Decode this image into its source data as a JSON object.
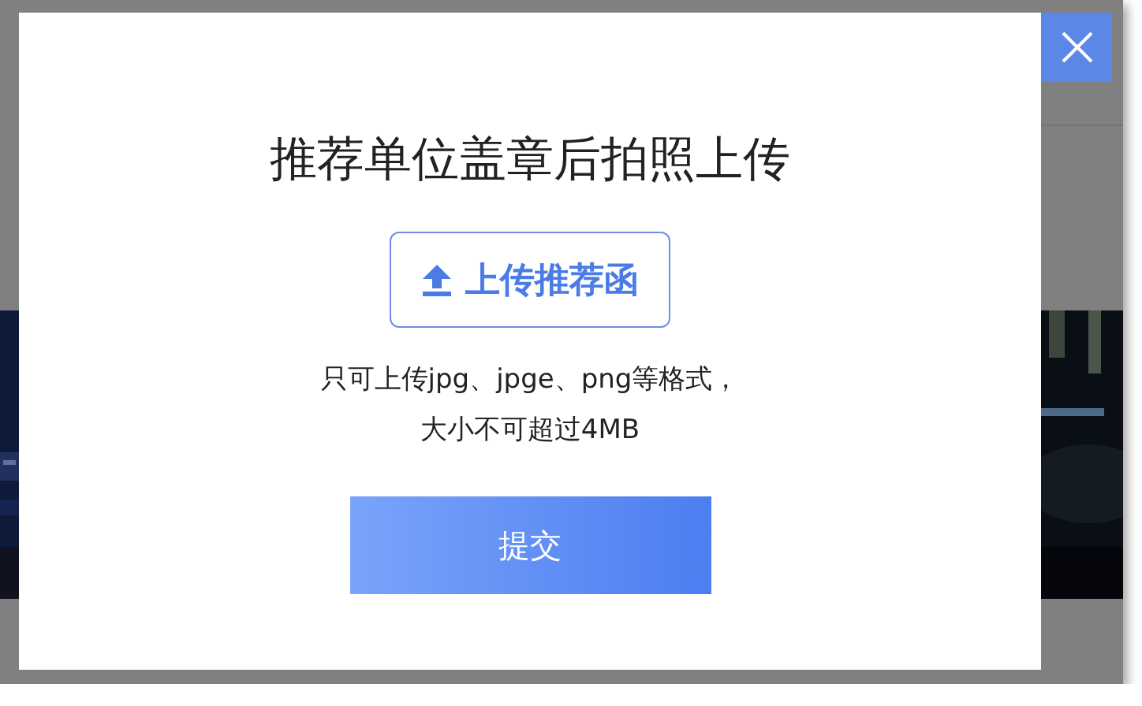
{
  "dialog": {
    "title": "推荐单位盖章后拍照上传",
    "upload_button": "上传推荐函",
    "hint_lines": [
      "只可上传jpg、jpge、png等格式，",
      "大小不可超过4MB"
    ],
    "submit_button": "提交"
  }
}
